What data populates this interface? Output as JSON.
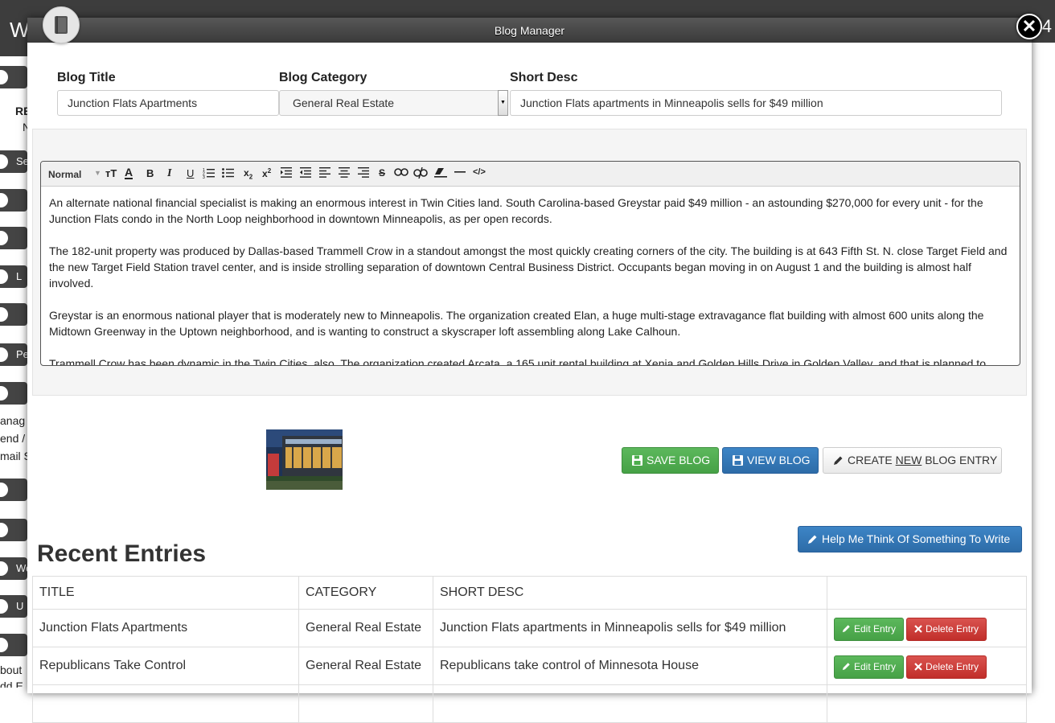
{
  "background": {
    "brand_fragment": "W",
    "right_number": "4",
    "side_texts": [
      "RE",
      "N",
      "Se",
      "L",
      "Pe",
      "anag",
      "end /",
      "mail S",
      "We",
      "U",
      "bout",
      "dd E"
    ]
  },
  "modal": {
    "title": "Blog Manager",
    "close_label": "✕"
  },
  "form": {
    "blog_title_label": "Blog Title",
    "blog_title_value": "Junction Flats Apartments",
    "category_label": "Blog Category",
    "category_value": "General Real Estate",
    "short_desc_label": "Short Desc",
    "short_desc_value": "Junction Flats apartments in Minneapolis sells for $49 million"
  },
  "editor": {
    "format_label": "Normal",
    "toolbar_icons": [
      "text-size-icon",
      "font-color-icon",
      "bold-icon",
      "italic-icon",
      "underline-icon",
      "ordered-list-icon",
      "bullet-list-icon",
      "subscript-icon",
      "superscript-icon",
      "indent-icon",
      "outdent-icon",
      "align-left-icon",
      "align-center-icon",
      "align-right-icon",
      "strikethrough-icon",
      "link-icon",
      "unlink-icon",
      "clear-format-icon",
      "horizontal-rule-icon",
      "code-view-icon"
    ],
    "paragraphs": [
      "An alternate national financial specialist is making an enormous interest in Twin Cities land. South Carolina-based Greystar paid $49 million - an astounding $270,000 for every unit - for the Junction Flats condo in the North Loop neighborhood in downtown Minneapolis, as per open records.",
      "The 182-unit property was produced by Dallas-based Trammell Crow in a standout amongst the most quickly creating corners of the city. The building is at 643 Fifth St. N. close Target Field and the new Target Field Station travel center, and is inside strolling separation of downtown Central Business District. Occupants began moving in on August 1 and the building is almost half involved.",
      "Greystar is an enormous national player that is moderately new to Minneapolis. The organization created Elan, a huge multi-stage extravagance flat building with almost 600 units along the Midtown Greenway in the Uptown neighborhood, and is wanting to construct a skyscraper loft assembling along Lake Calhoun.",
      "Trammell Crow has been dynamic in the Twin Cities, also. The organization created Arcata, a 165 unit rental building at Xenia and Golden Hills Drive in Golden Valley, and that is planned to"
    ]
  },
  "actions": {
    "save_label": "SAVE BLOG",
    "view_label": "VIEW BLOG",
    "create_pre": "CREATE ",
    "create_new": "NEW",
    "create_post": " BLOG ENTRY",
    "help_label": "Help Me Think Of Something To Write"
  },
  "recent": {
    "heading": "Recent Entries",
    "columns": [
      "TITLE",
      "CATEGORY",
      "SHORT DESC",
      ""
    ],
    "edit_label": "Edit Entry",
    "delete_label": "Delete Entry",
    "rows": [
      {
        "title": "Junction Flats Apartments",
        "category": "General Real Estate",
        "short_desc": "Junction Flats apartments in Minneapolis sells for $49 million"
      },
      {
        "title": "Republicans Take Control",
        "category": "General Real Estate",
        "short_desc": "Republicans take control of Minnesota House"
      }
    ]
  },
  "colors": {
    "green": "#5cb85c",
    "blue": "#3d85c6",
    "red": "#d9534f",
    "header": "#4a4a4a"
  }
}
